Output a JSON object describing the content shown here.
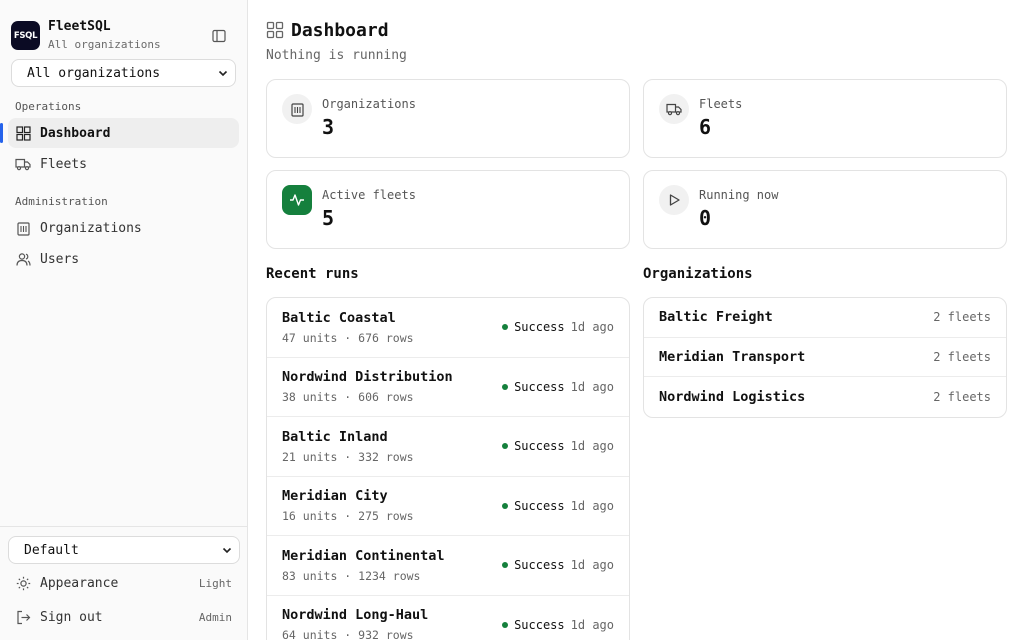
{
  "brand": {
    "logo_text": "FSQL",
    "title": "FleetSQL",
    "subtitle": "All organizations"
  },
  "org_select": {
    "value": "All organizations"
  },
  "nav": {
    "operations_label": "Operations",
    "operations": [
      {
        "label": "Dashboard",
        "icon": "dashboard-icon",
        "active": true
      },
      {
        "label": "Fleets",
        "icon": "truck-icon",
        "active": false
      }
    ],
    "administration_label": "Administration",
    "administration": [
      {
        "label": "Organizations",
        "icon": "building-icon"
      },
      {
        "label": "Users",
        "icon": "users-icon"
      }
    ]
  },
  "bottom": {
    "profile_select": "Default",
    "appearance_label": "Appearance",
    "appearance_value": "Light",
    "signout_label": "Sign out",
    "signout_value": "Admin"
  },
  "page": {
    "title": "Dashboard",
    "subtitle": "Nothing is running"
  },
  "stats": [
    {
      "label": "Organizations",
      "value": "3",
      "icon": "building-icon"
    },
    {
      "label": "Fleets",
      "value": "6",
      "icon": "truck-icon"
    },
    {
      "label": "Active fleets",
      "value": "5",
      "icon": "activity-icon"
    },
    {
      "label": "Running now",
      "value": "0",
      "icon": "play-icon"
    }
  ],
  "recent_runs": {
    "title": "Recent runs",
    "items": [
      {
        "name": "Baltic Coastal",
        "meta": "47 units · 676 rows",
        "status": "Success",
        "time": "1d ago"
      },
      {
        "name": "Nordwind Distribution",
        "meta": "38 units · 606 rows",
        "status": "Success",
        "time": "1d ago"
      },
      {
        "name": "Baltic Inland",
        "meta": "21 units · 332 rows",
        "status": "Success",
        "time": "1d ago"
      },
      {
        "name": "Meridian City",
        "meta": "16 units · 275 rows",
        "status": "Success",
        "time": "1d ago"
      },
      {
        "name": "Meridian Continental",
        "meta": "83 units · 1234 rows",
        "status": "Success",
        "time": "1d ago"
      },
      {
        "name": "Nordwind Long-Haul",
        "meta": "64 units · 932 rows",
        "status": "Success",
        "time": "1d ago"
      }
    ]
  },
  "organizations": {
    "title": "Organizations",
    "items": [
      {
        "name": "Baltic Freight",
        "count": "2 fleets"
      },
      {
        "name": "Meridian Transport",
        "count": "2 fleets"
      },
      {
        "name": "Nordwind Logistics",
        "count": "2 fleets"
      }
    ]
  },
  "colors": {
    "accent": "#2563eb",
    "success": "#15803d",
    "logo_bg": "#0b0b24"
  }
}
